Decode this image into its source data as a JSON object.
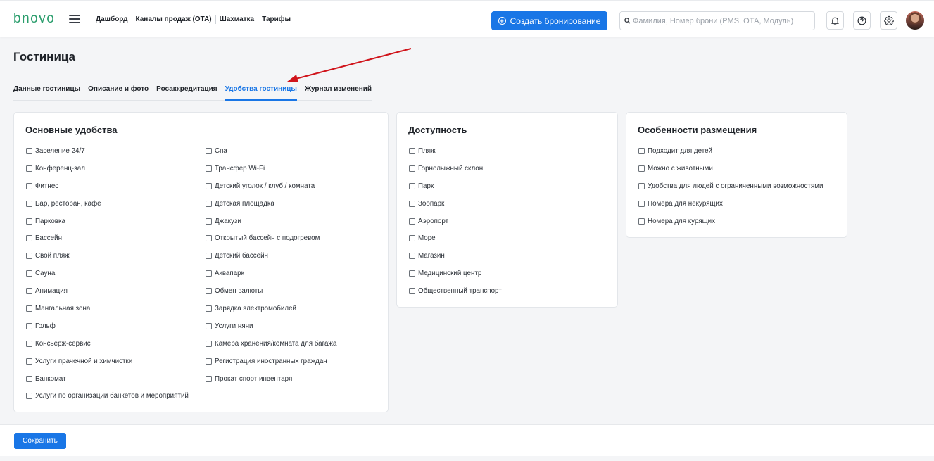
{
  "app": {
    "logo": "bnovo"
  },
  "header": {
    "nav": [
      "Дашборд",
      "Каналы продаж (ОТА)",
      "Шахматка",
      "Тарифы"
    ],
    "create_button": "Создать бронирование",
    "search_placeholder": "Фамилия, Номер брони (PMS, ОТА, Модуль)",
    "icons": [
      "menu-icon",
      "plus-circle-icon",
      "search-icon",
      "bell-icon",
      "help-icon",
      "gear-icon",
      "avatar"
    ]
  },
  "page": {
    "title": "Гостиница",
    "tabs": [
      {
        "label": "Данные гостиницы",
        "active": false
      },
      {
        "label": "Описание и фото",
        "active": false
      },
      {
        "label": "Росаккредитация",
        "active": false
      },
      {
        "label": "Удобства гостиницы",
        "active": true
      },
      {
        "label": "Журнал изменений",
        "active": false
      }
    ]
  },
  "sections": {
    "main": {
      "title": "Основные удобства",
      "col1": [
        "Заселение 24/7",
        "Конференц-зал",
        "Фитнес",
        "Бар, ресторан, кафе",
        "Парковка",
        "Бассейн",
        "Свой пляж",
        "Сауна",
        "Анимация",
        "Мангальная зона",
        "Гольф",
        "Консьерж-сервис",
        "Услуги прачечной и химчистки",
        "Банкомат",
        "Услуги по организации банкетов и мероприятий"
      ],
      "col2": [
        "Спа",
        "Трансфер Wi-Fi",
        "Детский уголок / клуб / комната",
        "Детская площадка",
        "Джакузи",
        "Открытый бассейн с подогревом",
        "Детский бассейн",
        "Аквапарк",
        "Обмен валюты",
        "Зарядка электромобилей",
        "Услуги няни",
        "Камера хранения/комната для багажа",
        "Регистрация иностранных граждан",
        "Прокат спорт инвентаря"
      ]
    },
    "access": {
      "title": "Доступность",
      "items": [
        "Пляж",
        "Горнолыжный склон",
        "Парк",
        "Зоопарк",
        "Аэропорт",
        "Море",
        "Магазин",
        "Медицинский центр",
        "Общественный транспорт"
      ]
    },
    "features": {
      "title": "Особенности размещения",
      "items": [
        "Подходит для детей",
        "Можно с животными",
        "Удобства для людей с ограниченными возможностями",
        "Номера для некурящих",
        "Номера для курящих"
      ]
    }
  },
  "footer": {
    "save_button": "Сохранить"
  },
  "colors": {
    "primary": "#1976e6",
    "logo": "#2a9d6c",
    "annotation_arrow": "#d0141b"
  }
}
